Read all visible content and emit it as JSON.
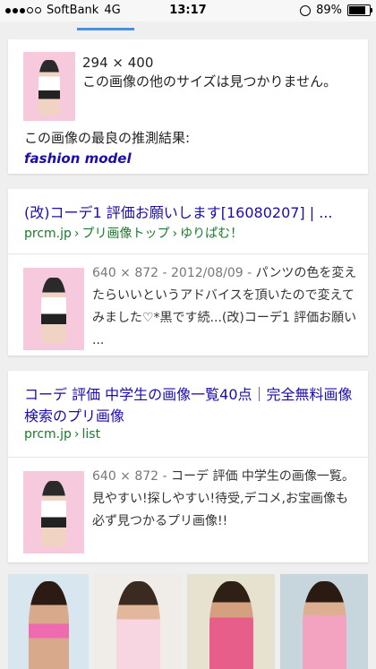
{
  "status_bar": {
    "carrier": "SoftBank",
    "network": "4G",
    "time": "13:17",
    "battery_percent": "89%",
    "battery_level": 0.89,
    "signal_bars_filled": 3,
    "signal_bars_total": 5
  },
  "image_info_card": {
    "size": "294 × 400",
    "no_other_sizes": "この画像の他のサイズは見つかりません。",
    "best_guess_label": "この画像の最良の推測結果:",
    "best_guess_link": "fashion model"
  },
  "results": [
    {
      "title": "(改)コーデ1 評価お願いします[16080207] | ...",
      "url_domain": "prcm.jp",
      "url_path": [
        "プリ画像トップ",
        "ゆりぱむ！"
      ],
      "meta": "640 × 872 - 2012/08/09 - ",
      "snippet": "パンツの色を変えたらいいというアドバイスを頂いたので変えてみました♡*黒です続...(改)コーデ1 評価お願い ..."
    },
    {
      "title": "コーデ 評価 中学生の画像一覧40点｜完全無料画像検索のプリ画像",
      "url_domain": "prcm.jp",
      "url_path": [
        "list"
      ],
      "meta": "640 × 872 - ",
      "snippet": "コーデ 評価 中学生の画像一覧。見やすい!探しやすい!待受,デコメ,お宝画像も必ず見つかるプリ画像!!"
    }
  ],
  "colors": {
    "link": "#1a0dab",
    "url": "#1a7a2c",
    "tab_indicator": "#4a90e2"
  }
}
